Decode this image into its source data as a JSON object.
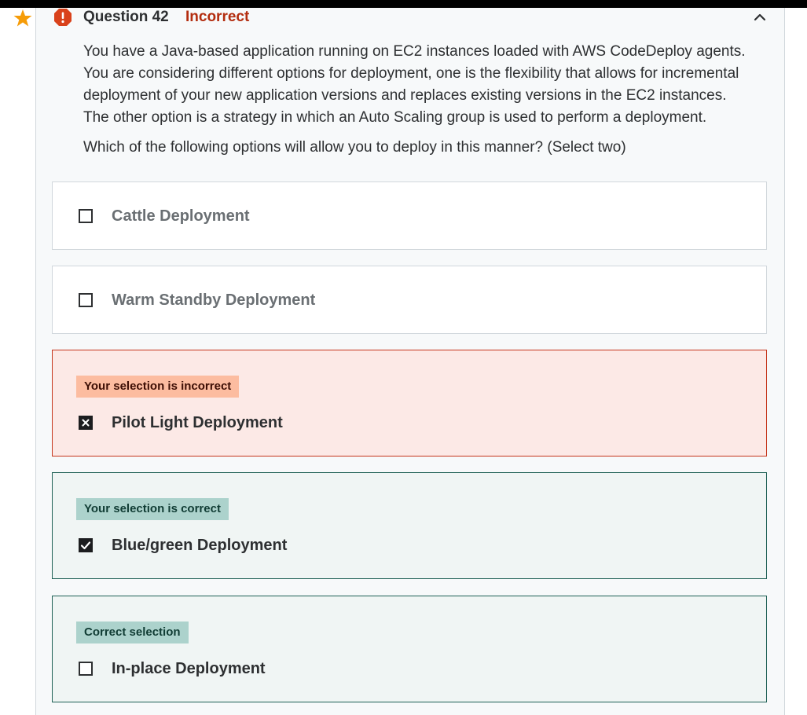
{
  "colors": {
    "star": "#f69c08",
    "alert": "#d9421b",
    "incorrect_text": "#b32d0f",
    "incorrect_bg": "#fce9e6",
    "incorrect_border": "#c5341a",
    "incorrect_tag": "#fcbca0",
    "correct_bg": "#f0f5f4",
    "correct_border": "#1e6055",
    "correct_tag": "#acd2cc"
  },
  "question": {
    "number_label": "Question 42",
    "status": "Incorrect",
    "icons": {
      "bookmark": "star-icon",
      "status": "alert-icon",
      "toggle": "chevron-up-icon"
    },
    "prompt_lines": [
      "You have a Java-based application running on EC2 instances loaded with AWS CodeDeploy agents.",
      "You are considering different options for deployment, one is the flexibility that allows for incremental",
      "deployment of your new application versions and replaces existing versions in the EC2 instances.",
      "The other option is a strategy in which an Auto Scaling group is used to perform a deployment."
    ],
    "ask": "Which of the following options will allow you to deploy in this manner? (Select two)"
  },
  "options": [
    {
      "label": "Cattle Deployment",
      "state": "unselected",
      "checkbox": "empty"
    },
    {
      "label": "Warm Standby Deployment",
      "state": "unselected",
      "checkbox": "empty"
    },
    {
      "label": "Pilot Light Deployment",
      "state": "incorrect",
      "checkbox": "x-mark",
      "tag": "Your selection is incorrect"
    },
    {
      "label": "Blue/green Deployment",
      "state": "correct",
      "checkbox": "check-mark",
      "tag": "Your selection is correct"
    },
    {
      "label": "In-place Deployment",
      "state": "missed",
      "checkbox": "empty",
      "tag": "Correct selection"
    }
  ]
}
